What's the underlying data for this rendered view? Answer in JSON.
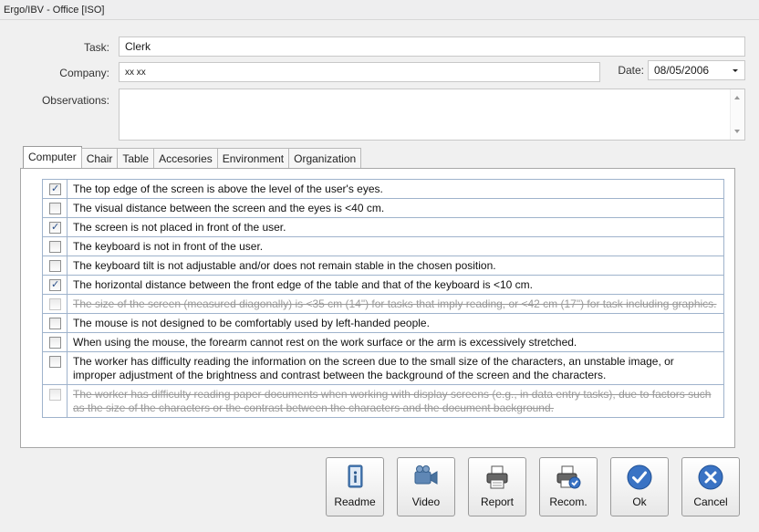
{
  "window": {
    "title": "Ergo/IBV - Office [ISO]"
  },
  "form": {
    "task_label": "Task:",
    "task_value": "Clerk",
    "company_label": "Company:",
    "company_value": "xx xx",
    "date_label": "Date:",
    "date_value": "08/05/2006",
    "observations_label": "Observations:",
    "observations_value": ""
  },
  "tabs": [
    {
      "label": "Computer",
      "active": true
    },
    {
      "label": "Chair",
      "active": false
    },
    {
      "label": "Table",
      "active": false
    },
    {
      "label": "Accesories",
      "active": false
    },
    {
      "label": "Environment",
      "active": false
    },
    {
      "label": "Organization",
      "active": false
    }
  ],
  "checklist": [
    {
      "text": "The top edge of the screen is above the level of the user's eyes.",
      "checked": true,
      "disabled": false
    },
    {
      "text": "The visual distance between the screen and the eyes is <40 cm.",
      "checked": false,
      "disabled": false
    },
    {
      "text": "The screen is not placed in front of the user.",
      "checked": true,
      "disabled": false
    },
    {
      "text": "The keyboard is not in front of the user.",
      "checked": false,
      "disabled": false
    },
    {
      "text": "The keyboard tilt is not adjustable and/or does not remain stable in the chosen position.",
      "checked": false,
      "disabled": false
    },
    {
      "text": "The horizontal distance between the front edge of the table and that of the keyboard is <10 cm.",
      "checked": true,
      "disabled": false
    },
    {
      "text": "The size of the screen (measured diagonally) is <35 cm (14\") for tasks that imply reading, or <42 cm (17\") for task including graphics.",
      "checked": false,
      "disabled": true
    },
    {
      "text": "The mouse is not designed to be comfortably used by left-handed people.",
      "checked": false,
      "disabled": false
    },
    {
      "text": "When using the mouse, the forearm cannot rest on the work surface or the arm is excessively stretched.",
      "checked": false,
      "disabled": false
    },
    {
      "text": "The worker has difficulty reading the information on the screen due to the small size of the characters, an unstable image, or improper adjustment of the brightness and contrast between the background of the screen and the characters.",
      "checked": false,
      "disabled": false
    },
    {
      "text": "The worker has difficulty reading paper documents when working with display screens (e.g., in data entry tasks), due to factors such as the size of the characters or the contrast between the characters and the document background.",
      "checked": false,
      "disabled": true
    }
  ],
  "buttons": {
    "readme": "Readme",
    "video": "Video",
    "report": "Report",
    "recom": "Recom.",
    "ok": "Ok",
    "cancel": "Cancel"
  },
  "icons": {
    "readme": "readme-document-icon",
    "video": "video-camera-icon",
    "report": "printer-icon",
    "recom": "printer-check-icon",
    "ok": "ok-checkmark-icon",
    "cancel": "cancel-x-icon"
  },
  "colors": {
    "accent": "#3a73c4",
    "grid_border": "#9fb3cc",
    "check_tick": "#2a4f8a"
  }
}
